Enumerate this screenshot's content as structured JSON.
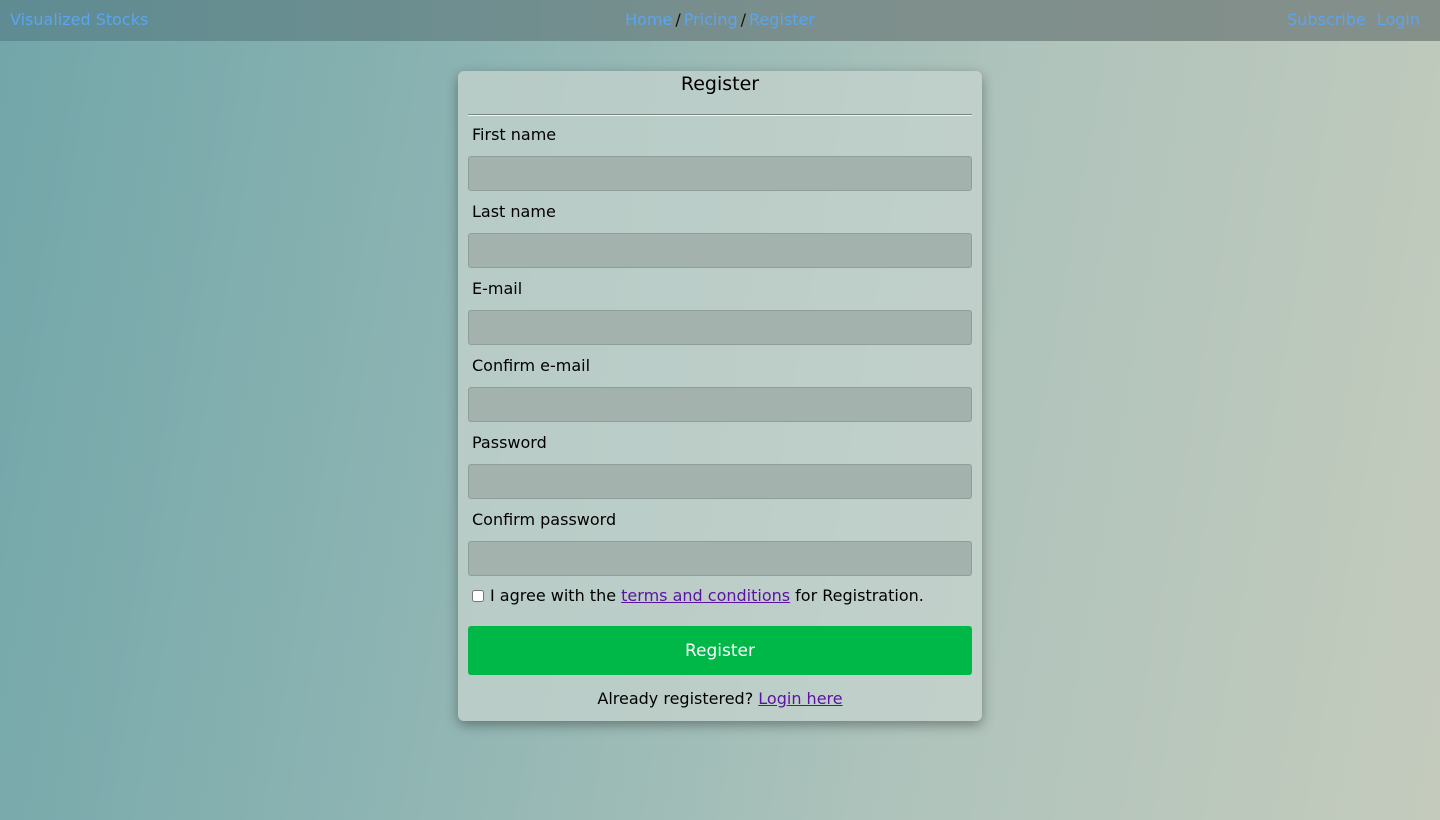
{
  "nav": {
    "brand": "Visualized Stocks",
    "breadcrumb": {
      "home": "Home",
      "pricing": "Pricing",
      "register": "Register",
      "separator": "/"
    },
    "subscribe": "Subscribe",
    "login": "Login"
  },
  "form": {
    "title": "Register",
    "fields": [
      {
        "label": "First name",
        "value": ""
      },
      {
        "label": "Last name",
        "value": ""
      },
      {
        "label": "E-mail",
        "value": ""
      },
      {
        "label": "Confirm e-mail",
        "value": ""
      },
      {
        "label": "Password",
        "value": ""
      },
      {
        "label": "Confirm password",
        "value": ""
      }
    ],
    "agree_prefix": "I agree with the",
    "agree_link": "terms and conditions",
    "agree_suffix": "for Registration.",
    "agree_checked": false,
    "submit_label": "Register",
    "already_text": "Already registered?",
    "login_link": "Login here"
  },
  "colors": {
    "link": "#5aa4f0",
    "visited_link": "#5b12a3",
    "button": "#00b847"
  }
}
